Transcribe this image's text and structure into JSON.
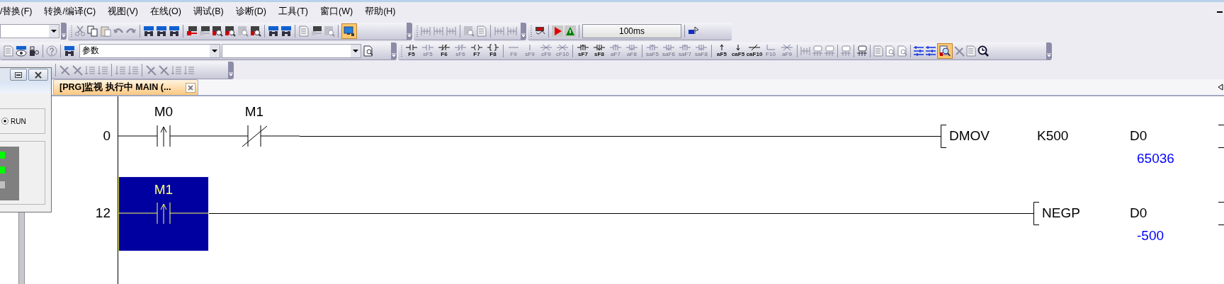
{
  "menu": [
    {
      "label": "/替换(F)"
    },
    {
      "label": "转换/编译(C)"
    },
    {
      "label": "视图(V)"
    },
    {
      "label": "在线(O)"
    },
    {
      "label": "调试(B)"
    },
    {
      "label": "诊断(D)"
    },
    {
      "label": "工具(T)"
    },
    {
      "label": "窗口(W)"
    },
    {
      "label": "帮助(H)"
    }
  ],
  "toolbar": {
    "monitor_interval": "100ms",
    "search_combo": {
      "value": "参数"
    },
    "toggle_buttons": [
      {
        "pressed": true
      },
      {
        "pressed": true
      }
    ]
  },
  "function_keys": [
    {
      "label": "F5",
      "disabled": false
    },
    {
      "label": "sF5",
      "disabled": true
    },
    {
      "label": "F6",
      "disabled": false
    },
    {
      "label": "sF6",
      "disabled": true
    },
    {
      "label": "F7",
      "disabled": false
    },
    {
      "label": "F8",
      "disabled": false
    },
    {
      "label": "F9",
      "disabled": true
    },
    {
      "label": "sF9",
      "disabled": true
    },
    {
      "label": "cF9",
      "disabled": true
    },
    {
      "label": "cF10",
      "disabled": true
    },
    {
      "label": "sF7",
      "disabled": false
    },
    {
      "label": "sF8",
      "disabled": false
    },
    {
      "label": "aF7",
      "disabled": true
    },
    {
      "label": "aF8",
      "disabled": true
    },
    {
      "label": "saF5",
      "disabled": true
    },
    {
      "label": "saF6",
      "disabled": true
    },
    {
      "label": "saF7",
      "disabled": true
    },
    {
      "label": "saF8",
      "disabled": true
    },
    {
      "label": "aF5",
      "disabled": false
    },
    {
      "label": "caF5",
      "disabled": false
    },
    {
      "label": "caF10",
      "disabled": false
    },
    {
      "label": "F10",
      "disabled": true
    },
    {
      "label": "aF9",
      "disabled": true
    }
  ],
  "status_window": {
    "run_option": {
      "label": "RUN",
      "selected": true
    },
    "leds": [
      {
        "color": "#00ff00"
      },
      {
        "color": "#00ff00"
      },
      {
        "color": "#c0c0c0"
      }
    ]
  },
  "tab": {
    "title": "[PRG]监视 执行中 MAIN (...",
    "selected": true
  },
  "ladder": {
    "rungs": [
      {
        "step": "0",
        "contacts": [
          {
            "device": "M0",
            "kind": "rising",
            "selected": false
          },
          {
            "device": "M1",
            "kind": "nc",
            "selected": false
          }
        ],
        "instruction": {
          "name": "DMOV",
          "operands": [
            {
              "device": "K500"
            },
            {
              "device": "D0",
              "value": "65036"
            }
          ]
        }
      },
      {
        "step": "12",
        "contacts": [
          {
            "device": "M1",
            "kind": "rising",
            "selected": true
          }
        ],
        "instruction": {
          "name": "NEGP",
          "operands": [
            {
              "device": "D0",
              "value": "-500"
            }
          ]
        }
      }
    ]
  }
}
